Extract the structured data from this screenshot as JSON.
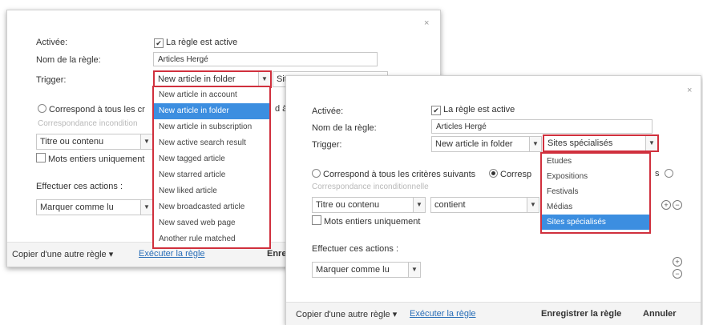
{
  "dialog1": {
    "close": "×",
    "activee_label": "Activée:",
    "active_checkbox_label": "La règle est active",
    "checkbox_mark": "✔",
    "rule_name_label": "Nom de la règle:",
    "rule_name_value": "Articles Hergé",
    "trigger_label": "Trigger:",
    "trigger_value": "New article in folder",
    "second_select_partial": "Site",
    "match_all_partial": "Correspond à tous les cr",
    "match_tail": "d à",
    "unconditional_partial": "Correspondance incondition",
    "field_select": "Titre ou contenu",
    "whole_words_partial": "Mots entiers uniquement",
    "actions_label": "Effectuer ces actions :",
    "action_select": "Marquer comme lu",
    "copy_rule": "Copier d'une autre règle",
    "run_rule": "Exécuter la règle",
    "save_partial": "Enre",
    "dropdown_items": [
      "New article in account",
      "New article in folder",
      "New article in subscription",
      "New active search result",
      "New tagged article",
      "New starred article",
      "New liked article",
      "New broadcasted article",
      "New saved web page",
      "Another rule matched"
    ],
    "dropdown_selected_index": 1
  },
  "dialog2": {
    "close": "×",
    "activee_label": "Activée:",
    "active_checkbox_label": "La règle est active",
    "checkbox_mark": "✔",
    "rule_name_label": "Nom de la règle:",
    "rule_name_value": "Articles Hergé",
    "trigger_label": "Trigger:",
    "trigger_value": "New article in folder",
    "folder_value": "Sites spécialisés",
    "match_all": "Correspond à tous les critères suivants",
    "match_second_partial": "Corresp",
    "match_tail": "s",
    "unconditional": "Correspondance inconditionnelle",
    "field_select": "Titre ou contenu",
    "op_select": "contient",
    "whole_words": "Mots entiers uniquement",
    "actions_label": "Effectuer ces actions :",
    "action_select": "Marquer comme lu",
    "copy_rule": "Copier d'une autre règle",
    "run_rule": "Exécuter la règle",
    "save": "Enregistrer la règle",
    "cancel": "Annuler",
    "plus": "+",
    "minus": "−",
    "folder_options": [
      "Etudes",
      "Expositions",
      "Festivals",
      "Médias",
      "Sites spécialisés"
    ],
    "folder_selected_index": 4
  },
  "arrow": "▼",
  "caret": "▾",
  "accent_color": "#d0303d",
  "selection_color": "#3c8ee0"
}
